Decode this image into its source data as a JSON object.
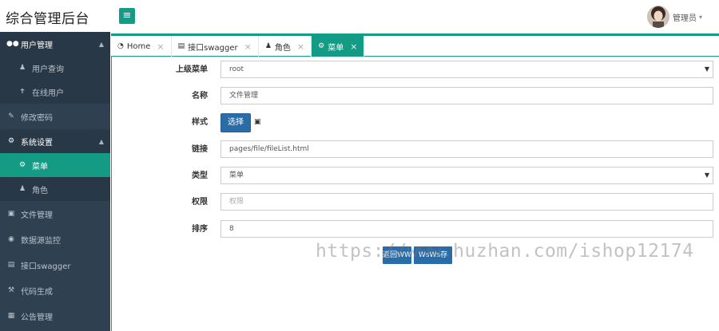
{
  "header": {
    "brand": "综合管理后台",
    "menu_toggle_icon": "hamburger-icon",
    "user_name": "管理员",
    "caret": "▾"
  },
  "sidebar": {
    "items": [
      {
        "label": "用户管理",
        "icon": "users-icon",
        "type": "group"
      },
      {
        "label": "用户查询",
        "icon": "user-icon",
        "type": "sub"
      },
      {
        "label": "在线用户",
        "icon": "online-user-icon",
        "type": "sub"
      },
      {
        "label": "修改密码",
        "icon": "edit-icon",
        "type": "top"
      },
      {
        "label": "系统设置",
        "icon": "cogs-icon",
        "type": "group"
      },
      {
        "label": "菜单",
        "icon": "gear-icon",
        "type": "sub-active"
      },
      {
        "label": "角色",
        "icon": "role-icon",
        "type": "sub"
      },
      {
        "label": "文件管理",
        "icon": "folder-icon",
        "type": "top"
      },
      {
        "label": "数据源监控",
        "icon": "eye-icon",
        "type": "top"
      },
      {
        "label": "接口swagger",
        "icon": "file-icon",
        "type": "top"
      },
      {
        "label": "代码生成",
        "icon": "wrench-icon",
        "type": "top"
      },
      {
        "label": "公告管理",
        "icon": "book-icon",
        "type": "top"
      }
    ]
  },
  "tabs": [
    {
      "label": "Home",
      "icon": "dashboard-icon",
      "active": false
    },
    {
      "label": "接口swagger",
      "icon": "file-icon",
      "active": false
    },
    {
      "label": "角色",
      "icon": "role-icon",
      "active": false
    },
    {
      "label": "菜单",
      "icon": "gear-icon",
      "active": true
    }
  ],
  "form": {
    "parent_label": "上级菜单",
    "parent_value": "root",
    "name_label": "名称",
    "name_value": "文件管理",
    "style_label": "样式",
    "style_button": "选择",
    "link_label": "链接",
    "link_value": "pages/file/fileList.html",
    "type_label": "类型",
    "type_value": "菜单",
    "permission_label": "权限",
    "permission_placeholder": "权限",
    "sort_label": "排序",
    "sort_value": "8",
    "back_button": "返回WW",
    "save_button": "WsWs存"
  },
  "watermark": "https://www.huzhan.com/ishop12174",
  "colors": {
    "accent": "#139b86",
    "sidebar_bg": "#2f4050",
    "button_blue": "#2a6ca8"
  }
}
